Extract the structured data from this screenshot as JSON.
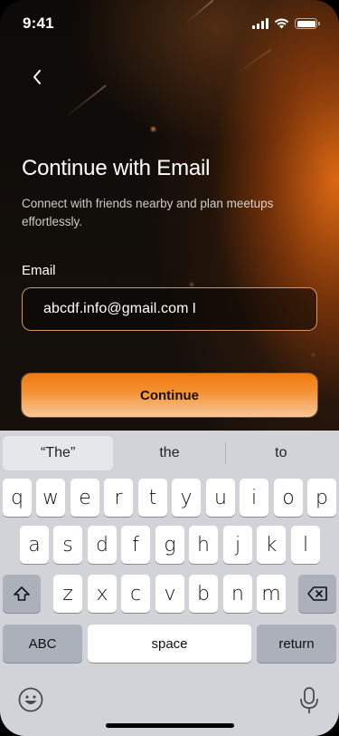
{
  "status_bar": {
    "time": "9:41"
  },
  "header": {
    "title": "Continue with Email",
    "subtitle": "Connect with friends nearby and plan meetups effortlessly."
  },
  "form": {
    "email_label": "Email",
    "email_value": "abcdf.info@gmail.com",
    "continue_label": "Continue"
  },
  "keyboard": {
    "suggestions": [
      "“The”",
      "the",
      "to"
    ],
    "row1": [
      "q",
      "w",
      "e",
      "r",
      "t",
      "y",
      "u",
      "i",
      "o",
      "p"
    ],
    "row2": [
      "a",
      "s",
      "d",
      "f",
      "g",
      "h",
      "j",
      "k",
      "l"
    ],
    "row3": [
      "z",
      "x",
      "c",
      "v",
      "b",
      "n",
      "m"
    ],
    "mode_label": "ABC",
    "space_label": "space",
    "return_label": "return"
  },
  "colors": {
    "accent": "#f07a10",
    "field_border": "#ffaa6e",
    "keyboard_bg": "#d1d3d9"
  }
}
